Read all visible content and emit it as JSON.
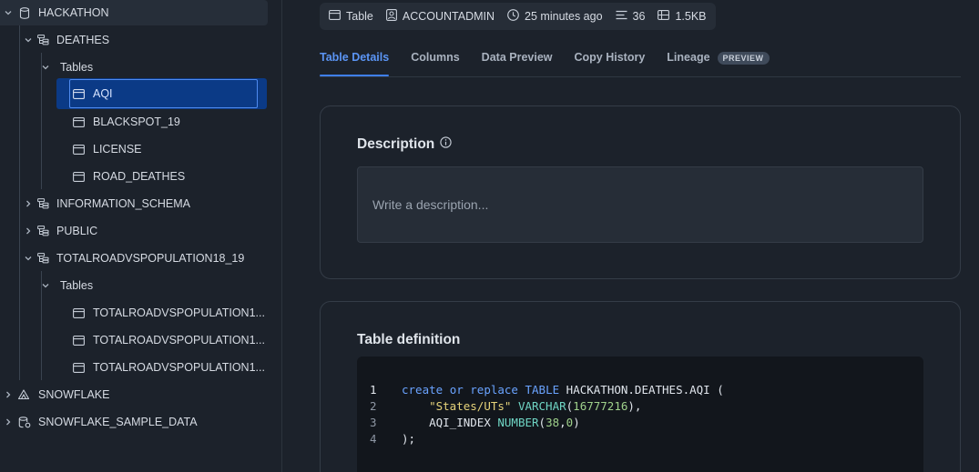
{
  "sidebar": {
    "db_hackathon": "HACKATHON",
    "schema_deathes": "DEATHES",
    "tables_label_1": "Tables",
    "tables": [
      "AQI",
      "BLACKSPOT_19",
      "LICENSE",
      "ROAD_DEATHES"
    ],
    "schema_info": "INFORMATION_SCHEMA",
    "schema_public": "PUBLIC",
    "schema_total": "TOTALROADVSPOPULATION18_19",
    "tables_label_2": "Tables",
    "total_tables": [
      "TOTALROADVSPOPULATION1...",
      "TOTALROADVSPOPULATION1...",
      "TOTALROADVSPOPULATION1..."
    ],
    "db_snowflake": "SNOWFLAKE",
    "db_sample": "SNOWFLAKE_SAMPLE_DATA"
  },
  "meta": {
    "type": "Table",
    "owner": "ACCOUNTADMIN",
    "time": "25 minutes ago",
    "rows": "36",
    "size": "1.5KB"
  },
  "tabs": {
    "details": "Table Details",
    "columns": "Columns",
    "preview": "Data Preview",
    "history": "Copy History",
    "lineage": "Lineage",
    "lineage_badge": "PREVIEW"
  },
  "description": {
    "title": "Description",
    "placeholder": "Write a description..."
  },
  "definition": {
    "title": "Table definition",
    "line_numbers": [
      "1",
      "2",
      "3",
      "4"
    ],
    "l1_create": "create",
    "l1_or": "or",
    "l1_replace": "replace",
    "l1_table": "TABLE",
    "l1_name": "HACKATHON.DEATHES.AQI (",
    "l2_col": "\"States/UTs\"",
    "l2_type": "VARCHAR",
    "l2_open": "(",
    "l2_len": "16777216",
    "l2_close": "),",
    "l3_col": "AQI_INDEX",
    "l3_type": "NUMBER",
    "l3_open": "(",
    "l3_p": "38",
    "l3_comma": ",",
    "l3_s": "0",
    "l3_close": ")",
    "l4": ");"
  },
  "colors": {
    "accent": "#3f7ff0",
    "selected_row": "#0b3a86",
    "background": "#1c222b"
  }
}
